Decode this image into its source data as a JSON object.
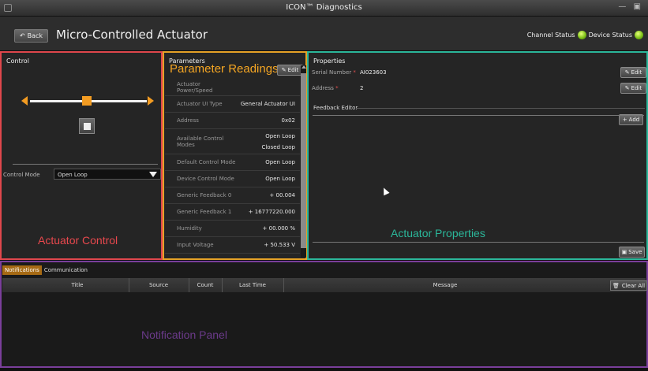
{
  "window": {
    "title": "ICON™ Diagnostics",
    "controls": "— ▣"
  },
  "header": {
    "back_label": "Back",
    "page_title": "Micro-Controlled Actuator",
    "channel_status_label": "Channel Status",
    "device_status_label": "Device Status",
    "led_color": "#7fc218"
  },
  "control_panel": {
    "title": "Control",
    "slider_value": 0.5,
    "control_mode_label": "Control Mode",
    "control_mode_value": "Open Loop",
    "overlay_label": "Actuator Control",
    "border_color": "#e0474c"
  },
  "parameters": {
    "title": "Parameters",
    "heading": "Parameter Readings",
    "edit_label": "Edit",
    "overlay_label": "",
    "border_color": "#e5a126",
    "rows": [
      {
        "key": "Actuator Power/Speed",
        "values": [
          ""
        ]
      },
      {
        "key": "Actuator UI Type",
        "values": [
          "General Actuator UI"
        ]
      },
      {
        "key": "Address",
        "values": [
          "0x02"
        ]
      },
      {
        "key": "Available Control Modes",
        "values": [
          "Open Loop",
          "Closed Loop"
        ]
      },
      {
        "key": "Default Control Mode",
        "values": [
          "Open Loop"
        ]
      },
      {
        "key": "Device Control Mode",
        "values": [
          "Open Loop"
        ]
      },
      {
        "key": "Generic Feedback 0",
        "values": [
          "+ 00.004"
        ]
      },
      {
        "key": "Generic Feedback 1",
        "values": [
          "+ 16777220.000"
        ]
      },
      {
        "key": "Humidity",
        "values": [
          "+ 00.000 %"
        ]
      },
      {
        "key": "Input Voltage",
        "values": [
          "+ 50.533 V"
        ]
      }
    ]
  },
  "properties": {
    "title": "Properties",
    "serial_label": "Serial Number",
    "serial_value": "AI023603",
    "address_label": "Address",
    "address_value": "2",
    "required_mark": "*",
    "edit_label": "Edit",
    "feedback_editor_label": "Feedback Editor",
    "add_label": "Add",
    "save_label": "Save",
    "overlay_label": "Actuator Properties",
    "border_color": "#2bb79a"
  },
  "notifications": {
    "tabs": [
      "Notifications",
      "Communication"
    ],
    "active_tab": "Notifications",
    "columns": [
      "Title",
      "Source",
      "Count",
      "Last Time",
      "Message"
    ],
    "clear_label": "Clear All",
    "overlay_label": "Notification Panel",
    "border_color": "#7a3f9b"
  }
}
